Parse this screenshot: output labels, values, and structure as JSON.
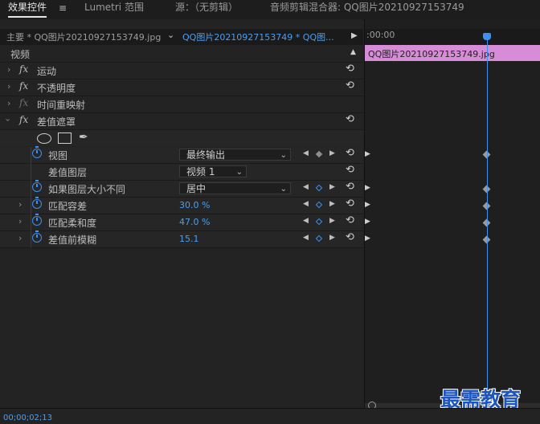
{
  "tabs": [
    {
      "label": "效果控件"
    },
    {
      "label": "Lumetri 范围"
    },
    {
      "label": "源：（无剪辑）"
    },
    {
      "label": "音频剪辑混合器: QQ图片20210927153749"
    }
  ],
  "source_bar": {
    "master": "主要 * QQ图片20210927153749.jpg",
    "clip": "QQ图片20210927153749 * QQ图...",
    "time": ":00:00"
  },
  "section_title": "视频",
  "effects": [
    {
      "name": "运动"
    },
    {
      "name": "不透明度"
    },
    {
      "name": "时间重映射"
    },
    {
      "name": "差值遮罩"
    }
  ],
  "params": {
    "view": {
      "label": "视图",
      "value": "最终输出"
    },
    "diff_layer": {
      "label": "差值图层",
      "value": "视频 1"
    },
    "size_mismatch": {
      "label": "如果图层大小不同",
      "value": "居中"
    },
    "match_tolerance": {
      "label": "匹配容差",
      "value": "30.0 %"
    },
    "match_softness": {
      "label": "匹配柔和度",
      "value": "47.0 %"
    },
    "blur_before": {
      "label": "差值前模糊",
      "value": "15.1"
    }
  },
  "timeline": {
    "clip_name": "QQ图片20210927153749.jpg"
  },
  "status": {
    "timecode": "00;00;02;13"
  },
  "watermark": "最需教育",
  "colors": {
    "accent_blue": "#3d8ff0",
    "clip_pink": "#d68cd6"
  }
}
